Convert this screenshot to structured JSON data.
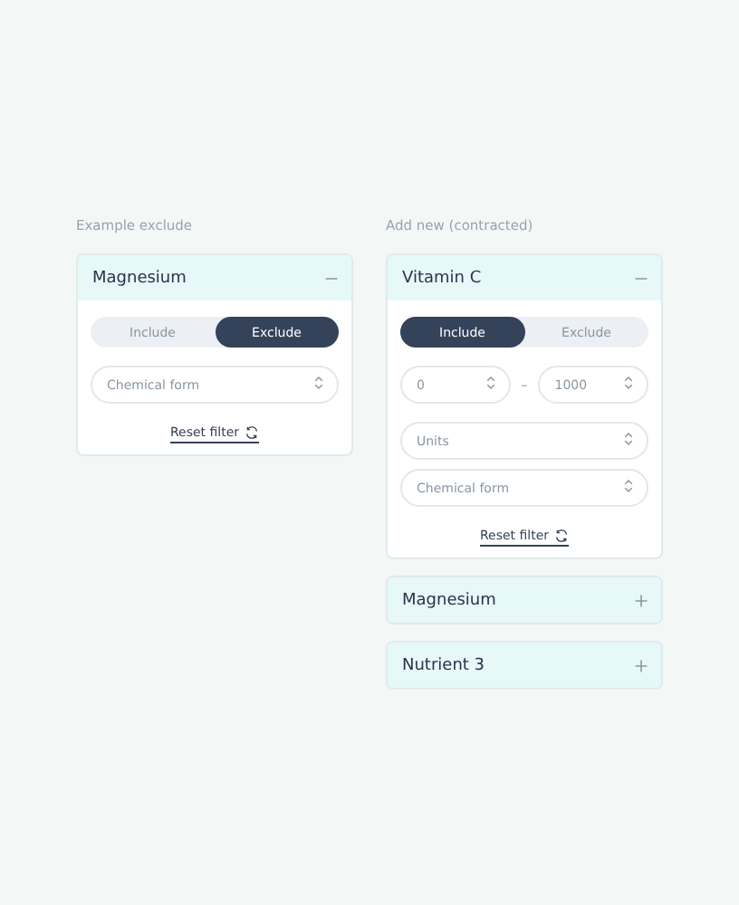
{
  "columns": [
    {
      "label": "Example exclude",
      "filters": [
        {
          "name": "Magnesium",
          "expanded": true,
          "toggle": [
            {
              "label": "Include",
              "selected": false
            },
            {
              "label": "Exclude",
              "selected": true
            }
          ],
          "fields": [
            {
              "kind": "select",
              "placeholder": "Chemical form"
            }
          ],
          "reset": "Reset filter"
        }
      ]
    },
    {
      "label": "Add new (contracted)",
      "filters": [
        {
          "name": "Vitamin C",
          "expanded": true,
          "toggle": [
            {
              "label": "Include",
              "selected": true
            },
            {
              "label": "Exclude",
              "selected": false
            }
          ],
          "fields": [
            {
              "kind": "range",
              "from": "0",
              "separator": "–",
              "to": "1000"
            },
            {
              "kind": "select",
              "placeholder": "Units"
            },
            {
              "kind": "select",
              "placeholder": "Chemical form"
            }
          ],
          "reset": "Reset filter"
        },
        {
          "name": "Magnesium",
          "expanded": false
        },
        {
          "name": "Nutrient 3",
          "expanded": false
        }
      ]
    }
  ]
}
